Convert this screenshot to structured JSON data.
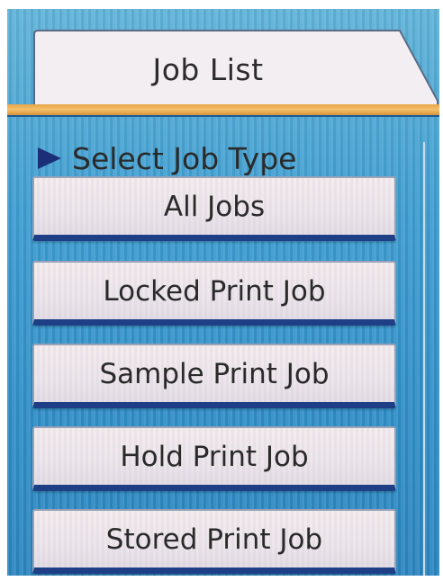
{
  "header": {
    "tab_title": "Job List"
  },
  "section": {
    "label": "Select Job Type"
  },
  "job_types": [
    {
      "label": "All Jobs"
    },
    {
      "label": "Locked Print Job"
    },
    {
      "label": "Sample Print Job"
    },
    {
      "label": "Hold Print Job"
    },
    {
      "label": "Stored Print Job"
    }
  ],
  "colors": {
    "screen_background": "#3d9dd0",
    "tab_accent": "#e8a64a",
    "button_underline": "#1e3f86",
    "arrow": "#1b2f78"
  },
  "icons": {
    "section_marker": "triangle-right-icon"
  }
}
